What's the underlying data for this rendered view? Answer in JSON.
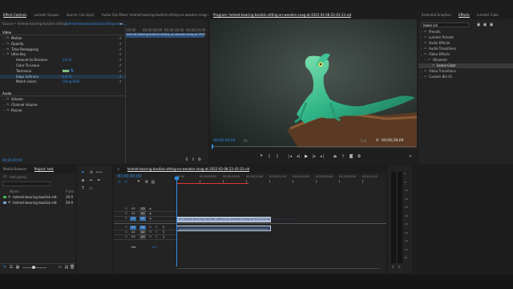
{
  "effect_controls": {
    "tabs": [
      "Effect Controls",
      "Lumetri Scopes",
      "Source: (no clips)",
      "Audio Clip Mixer: helmet-bearing-basilisk-sitting-on-wooden-snag-at-2022..."
    ],
    "source_label": "Source • helmet-bearing-basilisk-sitting...",
    "sequence_label": "helmet-bearing-basilisk-sitting-on-w...",
    "mini_timeline": {
      "start": "00:00",
      "t1": "00;00;08;00",
      "t2": "00;00;16;00",
      "t3": "00;00;24;00"
    },
    "clip_bar": "helmet-bearing-basilisk-sitting-on-wooden-snag-at-2022",
    "section_video": "Video",
    "rows": [
      {
        "label": "Motion",
        "indent": 1
      },
      {
        "label": "Opacity",
        "indent": 1
      },
      {
        "label": "Time Remapping",
        "indent": 1
      },
      {
        "label": "Ultra Key",
        "indent": 1
      },
      {
        "label": "Amount to Dissolve",
        "indent": 2,
        "value": "0.0 %"
      },
      {
        "label": "Color To Leave",
        "indent": 2
      },
      {
        "label": "Tolerance",
        "indent": 2,
        "value": "50.0 %"
      },
      {
        "label": "Edge Softness",
        "indent": 2,
        "value": "0.0 %"
      },
      {
        "label": "Match colors",
        "indent": 2,
        "value": "Using RGB"
      }
    ],
    "section_audio": "Audio",
    "audio_rows": [
      "Volume",
      "Channel Volume",
      "Panner"
    ],
    "timecode": "00;00;00;00"
  },
  "program_monitor": {
    "title": "Program: helmet-bearing-basilisk-sitting-on-wooden-snag-at-2022-02-08-22-43-33.vid",
    "timecode_in": "00;00;00;00",
    "fit": "Fit",
    "full": "Full",
    "timecode_out": "00;00;28;09"
  },
  "effects_panel": {
    "tabs": [
      "Essential Graphics",
      "Effects",
      "Lumetri Color"
    ],
    "search_value": "leave col",
    "tree": [
      {
        "label": "Presets",
        "indent": 1
      },
      {
        "label": "Lumetri Presets",
        "indent": 1
      },
      {
        "label": "Audio Effects",
        "indent": 1
      },
      {
        "label": "Audio Transitions",
        "indent": 1
      },
      {
        "label": "Video Effects",
        "indent": 1
      },
      {
        "label": "Obsolete",
        "indent": 2
      },
      {
        "label": "Leave Color",
        "indent": 3
      },
      {
        "label": "Video Transitions",
        "indent": 1
      },
      {
        "label": "Custom Bin 01",
        "indent": 1
      }
    ]
  },
  "project_panel": {
    "tabs": [
      "Media Browser",
      "Project: test"
    ],
    "project_name": "test.prproj",
    "header_name": "Name",
    "header_fr": "Fram",
    "items": [
      {
        "name": "helmet-bearing-basilisk-sitt",
        "fr": "29.9"
      },
      {
        "name": "helmet-bearing-basilisk-sitt",
        "fr": "29.9"
      }
    ]
  },
  "timeline": {
    "title": "helmet-bearing-basilisk-sitting-on-wooden-snag-at-2022-02-08-22-43-33.vid",
    "timecode": "00;00;00;00",
    "ruler": [
      "00;00",
      "00;00;08;00",
      "00;00;16;00",
      "00;00;24;00",
      "00;00;32;00",
      "00;00;40;00",
      "00;00;48;00",
      "00;00;56;00",
      "00;01;04;0"
    ],
    "tracks": [
      "V3",
      "V2",
      "V1",
      "A1",
      "A2",
      "A3"
    ],
    "source_v": "V1",
    "source_a": "A1",
    "master": "Mix",
    "master_val": "0.0",
    "clip_label": "fx helmet-bearing-basilisk-sitting-on-wooden-snag-at-2022-02-08-22-43-33.vid [V]"
  },
  "audio_meter": {
    "scale": [
      "0",
      "-6",
      "-12",
      "-18",
      "-24",
      "-30",
      "-36",
      "-42",
      "-48",
      "-54",
      "dB"
    ],
    "solo": "S",
    "solo2": "S"
  },
  "colors": {
    "accent": "#2f8ee8",
    "clip_video": "#9db0cc",
    "playhead": "#2f8ee8",
    "work_area": "#d33"
  }
}
